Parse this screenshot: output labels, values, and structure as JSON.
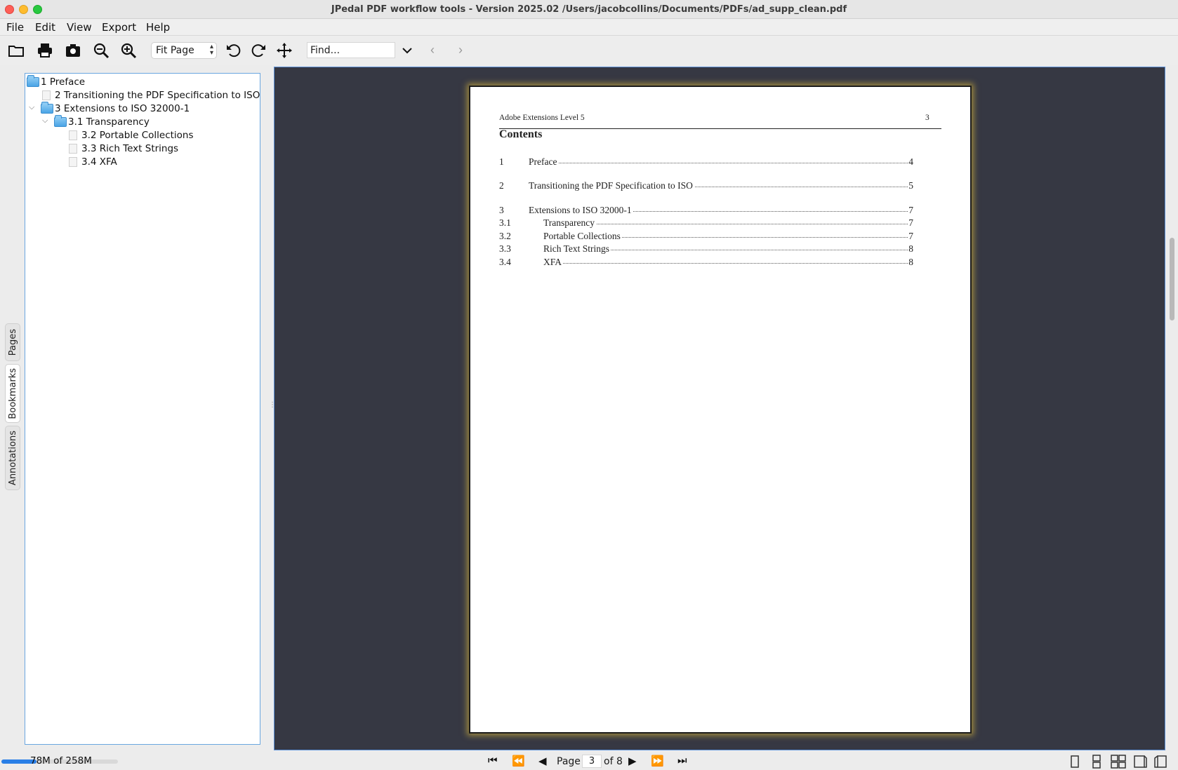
{
  "window": {
    "title": "JPedal PDF workflow tools - Version 2025.02 /Users/jacobcollins/Documents/PDFs/ad_supp_clean.pdf"
  },
  "menu": {
    "items": [
      "File",
      "Edit",
      "View",
      "Export",
      "Help"
    ]
  },
  "toolbar": {
    "buttons": [
      "open-file-icon",
      "print-icon",
      "snapshot-icon",
      "zoom-out-icon",
      "zoom-in-icon",
      "rotate-left-icon",
      "rotate-right-icon",
      "pan-icon"
    ],
    "zoom_value": "Fit Page",
    "find_placeholder": "Find...",
    "find_value": "Find..."
  },
  "side_tabs": {
    "pages": "Pages",
    "bookmarks": "Bookmarks",
    "annotations": "Annotations",
    "active": "Bookmarks"
  },
  "bookmarks": [
    {
      "label": "1 Preface",
      "type": "folder"
    },
    {
      "label": "2 Transitioning the PDF Specification to ISO",
      "type": "doc"
    },
    {
      "label": "3 Extensions to ISO 32000-1",
      "type": "folder",
      "expanded": true
    },
    {
      "label": "3.1 Transparency",
      "type": "folder",
      "expanded": true
    },
    {
      "label": "3.2 Portable Collections",
      "type": "doc"
    },
    {
      "label": "3.3 Rich Text Strings",
      "type": "doc"
    },
    {
      "label": "3.4 XFA",
      "type": "doc"
    }
  ],
  "document": {
    "header": "Adobe Extensions Level 5",
    "page_number": "3",
    "heading": "Contents",
    "toc": [
      {
        "num": "1",
        "title": "Preface",
        "page": "4"
      },
      {
        "num": "2",
        "title": "Transitioning the PDF Specification to ISO",
        "page": "5"
      },
      {
        "num": "3",
        "title": "Extensions to ISO 32000-1",
        "page": "7"
      },
      {
        "num": "3.1",
        "title": "Transparency",
        "page": "7"
      },
      {
        "num": "3.2",
        "title": "Portable Collections",
        "page": "7"
      },
      {
        "num": "3.3",
        "title": "Rich Text Strings",
        "page": "8"
      },
      {
        "num": "3.4",
        "title": "XFA",
        "page": "8"
      }
    ]
  },
  "status": {
    "memory": "78M of 258M",
    "memory_fraction": 0.3,
    "page_label": "Page",
    "current_page": "3",
    "of_label": "of 8"
  },
  "colors": {
    "viewer_bg": "#363843",
    "accent": "#2a7fe6",
    "page_glow": "#f0c83c"
  }
}
